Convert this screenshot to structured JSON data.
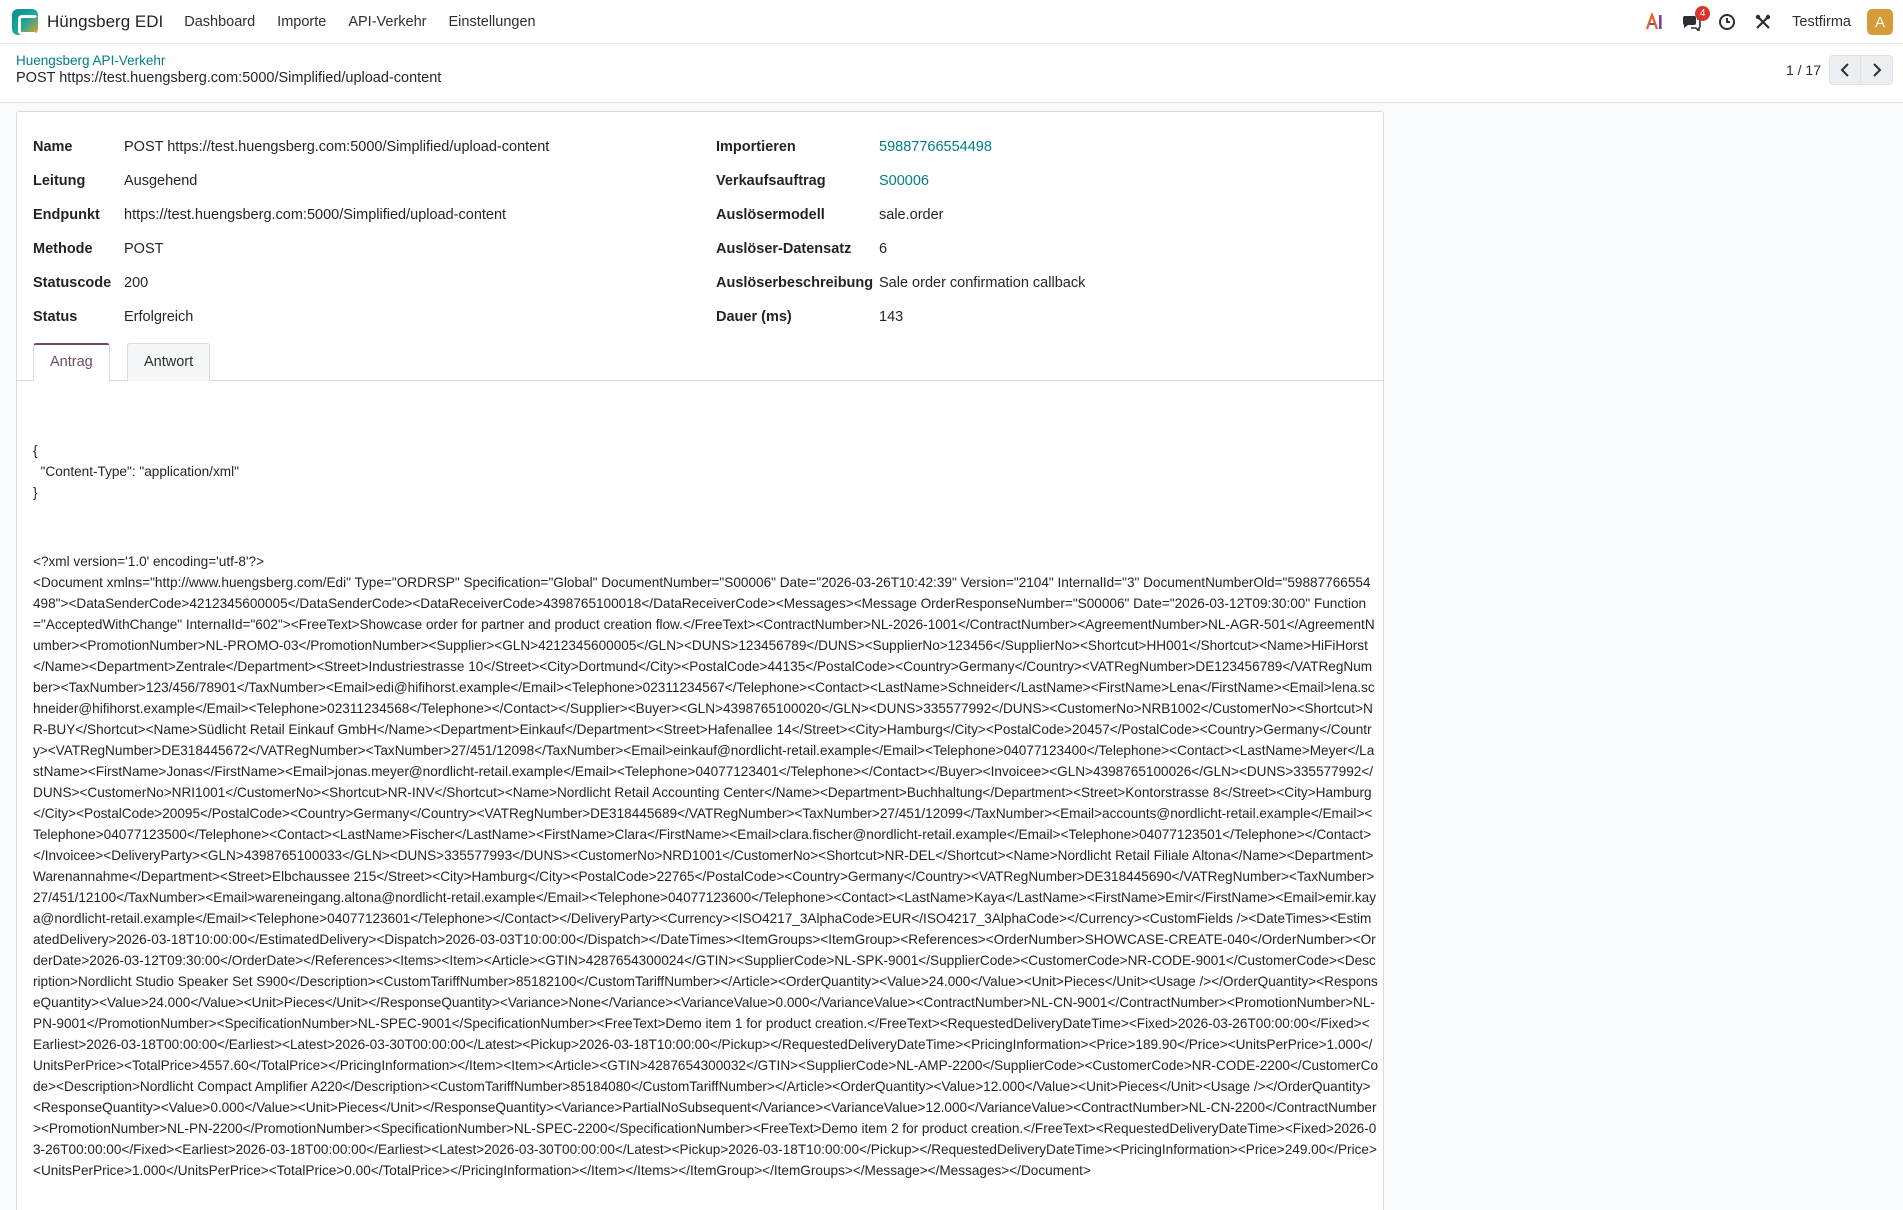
{
  "navbar": {
    "app_name": "Hüngsberg EDI",
    "menu": [
      "Dashboard",
      "Importe",
      "API-Verkehr",
      "Einstellungen"
    ],
    "icons": {
      "ai": "ai-icon",
      "discuss": "chat-bubbles-icon",
      "activity": "clock-icon",
      "debug": "tools-icon"
    },
    "discuss_badge": "4",
    "company": "Testfirma",
    "avatar_letter": "A"
  },
  "control_panel": {
    "breadcrumb": "Huengsberg API-Verkehr",
    "record_title": "POST https://test.huengsberg.com:5000/Simplified/upload-content",
    "pager": "1 / 17"
  },
  "form": {
    "left": [
      {
        "label": "Name",
        "value": "POST https://test.huengsberg.com:5000/Simplified/upload-content"
      },
      {
        "label": "Leitung",
        "value": "Ausgehend"
      },
      {
        "label": "Endpunkt",
        "value": "https://test.huengsberg.com:5000/Simplified/upload-content"
      },
      {
        "label": "Methode",
        "value": "POST"
      },
      {
        "label": "Statuscode",
        "value": "200"
      },
      {
        "label": "Status",
        "value": "Erfolgreich"
      }
    ],
    "right": [
      {
        "label": "Importieren",
        "value": "59887766554498",
        "link": true
      },
      {
        "label": "Verkaufsauftrag",
        "value": "S00006",
        "link": true
      },
      {
        "label": "Auslösermodell",
        "value": "sale.order"
      },
      {
        "label": "Auslöser-Datensatz",
        "value": "6"
      },
      {
        "label": "Auslöserbeschreibung",
        "value": "Sale order confirmation callback"
      },
      {
        "label": "Dauer (ms)",
        "value": "143"
      }
    ]
  },
  "tabs": {
    "active": "Antrag",
    "other": "Antwort"
  },
  "request": {
    "headers": "{\n  \"Content-Type\": \"application/xml\"\n}",
    "body": "<?xml version='1.0' encoding='utf-8'?>\n<Document xmlns=\"http://www.huengsberg.com/Edi\" Type=\"ORDRSP\" Specification=\"Global\" DocumentNumber=\"S00006\" Date=\"2026-03-26T10:42:39\" Version=\"2104\" InternalId=\"3\" DocumentNumberOld=\"59887766554498\"><DataSenderCode>4212345600005</DataSenderCode><DataReceiverCode>4398765100018</DataReceiverCode><Messages><Message OrderResponseNumber=\"S00006\" Date=\"2026-03-12T09:30:00\" Function=\"AcceptedWithChange\" InternalId=\"602\"><FreeText>Showcase order for partner and product creation flow.</FreeText><ContractNumber>NL-2026-1001</ContractNumber><AgreementNumber>NL-AGR-501</AgreementNumber><PromotionNumber>NL-PROMO-03</PromotionNumber><Supplier><GLN>4212345600005</GLN><DUNS>123456789</DUNS><SupplierNo>123456</SupplierNo><Shortcut>HH001</Shortcut><Name>HiFiHorst</Name><Department>Zentrale</Department><Street>Industriestrasse 10</Street><City>Dortmund</City><PostalCode>44135</PostalCode><Country>Germany</Country><VATRegNumber>DE123456789</VATRegNumber><TaxNumber>123/456/78901</TaxNumber><Email>edi@hifihorst.example</Email><Telephone>02311234567</Telephone><Contact><LastName>Schneider</LastName><FirstName>Lena</FirstName><Email>lena.schneider@hifihorst.example</Email><Telephone>02311234568</Telephone></Contact></Supplier><Buyer><GLN>4398765100020</GLN><DUNS>335577992</DUNS><CustomerNo>NRB1002</CustomerNo><Shortcut>NR-BUY</Shortcut><Name>Südlicht Retail Einkauf GmbH</Name><Department>Einkauf</Department><Street>Hafenallee 14</Street><City>Hamburg</City><PostalCode>20457</PostalCode><Country>Germany</Country><VATRegNumber>DE318445672</VATRegNumber><TaxNumber>27/451/12098</TaxNumber><Email>einkauf@nordlicht-retail.example</Email><Telephone>04077123400</Telephone><Contact><LastName>Meyer</LastName><FirstName>Jonas</FirstName><Email>jonas.meyer@nordlicht-retail.example</Email><Telephone>04077123401</Telephone></Contact></Buyer><Invoicee><GLN>4398765100026</GLN><DUNS>335577992</DUNS><CustomerNo>NRI1001</CustomerNo><Shortcut>NR-INV</Shortcut><Name>Nordlicht Retail Accounting Center</Name><Department>Buchhaltung</Department><Street>Kontorstrasse 8</Street><City>Hamburg</City><PostalCode>20095</PostalCode><Country>Germany</Country><VATRegNumber>DE318445689</VATRegNumber><TaxNumber>27/451/12099</TaxNumber><Email>accounts@nordlicht-retail.example</Email><Telephone>04077123500</Telephone><Contact><LastName>Fischer</LastName><FirstName>Clara</FirstName><Email>clara.fischer@nordlicht-retail.example</Email><Telephone>04077123501</Telephone></Contact></Invoicee><DeliveryParty><GLN>4398765100033</GLN><DUNS>335577993</DUNS><CustomerNo>NRD1001</CustomerNo><Shortcut>NR-DEL</Shortcut><Name>Nordlicht Retail Filiale Altona</Name><Department>Warenannahme</Department><Street>Elbchaussee 215</Street><City>Hamburg</City><PostalCode>22765</PostalCode><Country>Germany</Country><VATRegNumber>DE318445690</VATRegNumber><TaxNumber>27/451/12100</TaxNumber><Email>wareneingang.altona@nordlicht-retail.example</Email><Telephone>04077123600</Telephone><Contact><LastName>Kaya</LastName><FirstName>Emir</FirstName><Email>emir.kaya@nordlicht-retail.example</Email><Telephone>04077123601</Telephone></Contact></DeliveryParty><Currency><ISO4217_3AlphaCode>EUR</ISO4217_3AlphaCode></Currency><CustomFields /><DateTimes><EstimatedDelivery>2026-03-18T10:00:00</EstimatedDelivery><Dispatch>2026-03-03T10:00:00</Dispatch></DateTimes><ItemGroups><ItemGroup><References><OrderNumber>SHOWCASE-CREATE-040</OrderNumber><OrderDate>2026-03-12T09:30:00</OrderDate></References><Items><Item><Article><GTIN>4287654300024</GTIN><SupplierCode>NL-SPK-9001</SupplierCode><CustomerCode>NR-CODE-9001</CustomerCode><Description>Nordlicht Studio Speaker Set S900</Description><CustomTariffNumber>85182100</CustomTariffNumber></Article><OrderQuantity><Value>24.000</Value><Unit>Pieces</Unit><Usage /></OrderQuantity><ResponseQuantity><Value>24.000</Value><Unit>Pieces</Unit></ResponseQuantity><Variance>None</Variance><VarianceValue>0.000</VarianceValue><ContractNumber>NL-CN-9001</ContractNumber><PromotionNumber>NL-PN-9001</PromotionNumber><SpecificationNumber>NL-SPEC-9001</SpecificationNumber><FreeText>Demo item 1 for product creation.</FreeText><RequestedDeliveryDateTime><Fixed>2026-03-26T00:00:00</Fixed><Earliest>2026-03-18T00:00:00</Earliest><Latest>2026-03-30T00:00:00</Latest><Pickup>2026-03-18T10:00:00</Pickup></RequestedDeliveryDateTime><PricingInformation><Price>189.90</Price><UnitsPerPrice>1.000</UnitsPerPrice><TotalPrice>4557.60</TotalPrice></PricingInformation></Item><Item><Article><GTIN>4287654300032</GTIN><SupplierCode>NL-AMP-2200</SupplierCode><CustomerCode>NR-CODE-2200</CustomerCode><Description>Nordlicht Compact Amplifier A220</Description><CustomTariffNumber>85184080</CustomTariffNumber></Article><OrderQuantity><Value>12.000</Value><Unit>Pieces</Unit><Usage /></OrderQuantity><ResponseQuantity><Value>0.000</Value><Unit>Pieces</Unit></ResponseQuantity><Variance>PartialNoSubsequent</Variance><VarianceValue>12.000</VarianceValue><ContractNumber>NL-CN-2200</ContractNumber><PromotionNumber>NL-PN-2200</PromotionNumber><SpecificationNumber>NL-SPEC-2200</SpecificationNumber><FreeText>Demo item 2 for product creation.</FreeText><RequestedDeliveryDateTime><Fixed>2026-03-26T00:00:00</Fixed><Earliest>2026-03-18T00:00:00</Earliest><Latest>2026-03-30T00:00:00</Latest><Pickup>2026-03-18T10:00:00</Pickup></RequestedDeliveryDateTime><PricingInformation><Price>249.00</Price><UnitsPerPrice>1.000</UnitsPerPrice><TotalPrice>0.00</TotalPrice></PricingInformation></Item></Items></ItemGroup></ItemGroups></Message></Messages></Document>"
  },
  "colors": {
    "accent": "#017e84",
    "tab_active": "#714b67",
    "badge": "#d9342b",
    "avatar": "#d79b3a"
  }
}
